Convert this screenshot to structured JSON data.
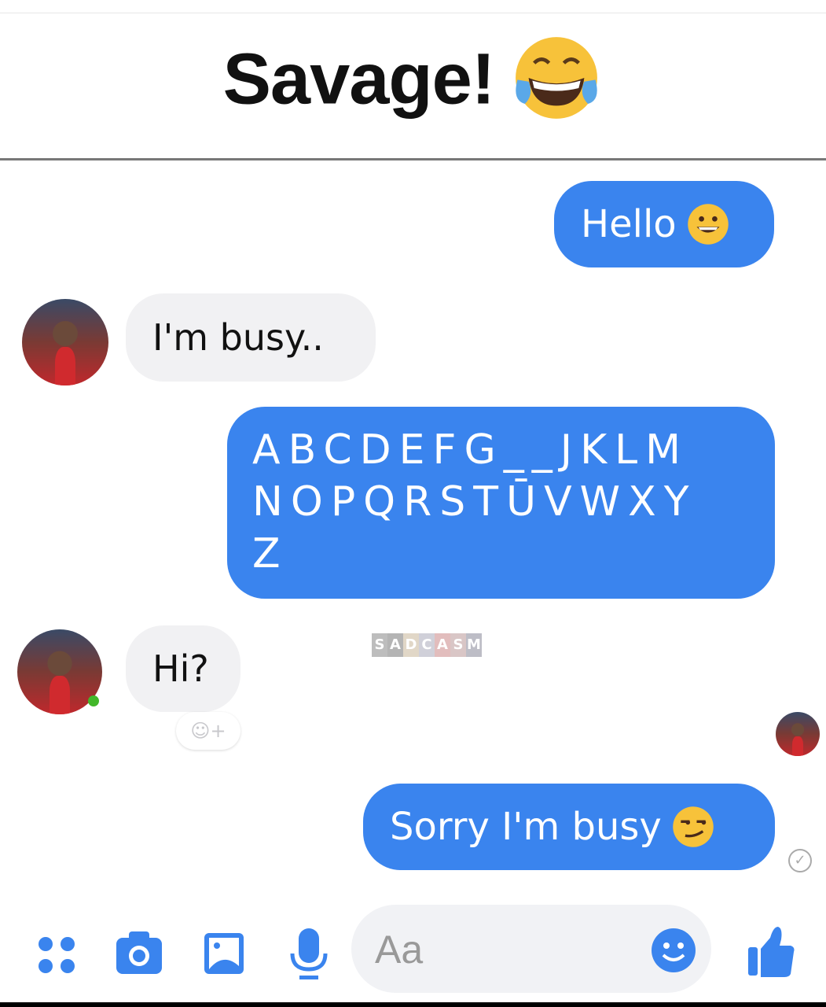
{
  "header": {
    "title": "Savage!",
    "emoji_icon": "tears-of-joy-emoji"
  },
  "colors": {
    "accent": "#3a84ee",
    "incoming_bubble": "#f1f1f3"
  },
  "messages": [
    {
      "from": "me",
      "text": "Hello",
      "emoji": "grinning-emoji"
    },
    {
      "from": "contact",
      "text": "I'm busy.."
    },
    {
      "from": "me",
      "text": "ABCDEFG__JKLM\nNOPQRSTŪVWXY\nZ"
    },
    {
      "from": "contact",
      "text": "Hi?"
    },
    {
      "from": "me",
      "text": "Sorry I'm busy",
      "emoji": "smirking-emoji"
    }
  ],
  "watermark": "SADCASM",
  "composer": {
    "placeholder": "Aa"
  }
}
